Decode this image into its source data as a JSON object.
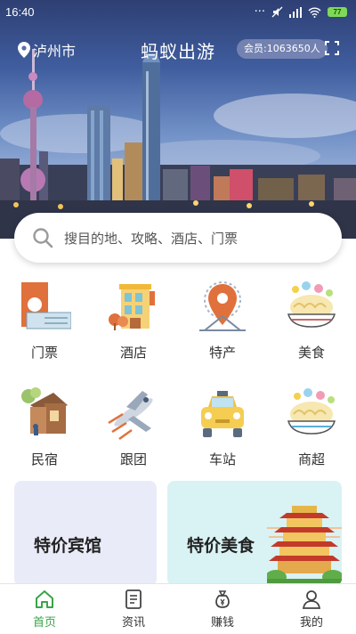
{
  "status_bar": {
    "time": "16:40",
    "battery": "77"
  },
  "header": {
    "location": "泸州市",
    "title": "蚂蚁出游",
    "member_badge": "会员:1063650人"
  },
  "search": {
    "placeholder": "搜目的地、攻略、酒店、门票"
  },
  "categories": [
    {
      "label": "门票",
      "icon": "ticket-icon"
    },
    {
      "label": "酒店",
      "icon": "hotel-icon"
    },
    {
      "label": "特产",
      "icon": "specialty-icon"
    },
    {
      "label": "美食",
      "icon": "food-icon"
    },
    {
      "label": "民宿",
      "icon": "homestay-icon"
    },
    {
      "label": "跟团",
      "icon": "group-tour-icon"
    },
    {
      "label": "车站",
      "icon": "station-icon"
    },
    {
      "label": "商超",
      "icon": "supermarket-icon"
    }
  ],
  "promos": [
    {
      "title": "特价宾馆",
      "bg": "#e9ecf8"
    },
    {
      "title": "特价美食",
      "bg": "#d9f2f4"
    }
  ],
  "bottom_nav": [
    {
      "label": "首页",
      "icon": "home-icon",
      "active": true
    },
    {
      "label": "资讯",
      "icon": "news-icon",
      "active": false
    },
    {
      "label": "赚钱",
      "icon": "money-bag-icon",
      "active": false
    },
    {
      "label": "我的",
      "icon": "profile-icon",
      "active": false
    }
  ],
  "colors": {
    "accent": "#3aa44a",
    "member_badge_bg": "#8c96be"
  }
}
